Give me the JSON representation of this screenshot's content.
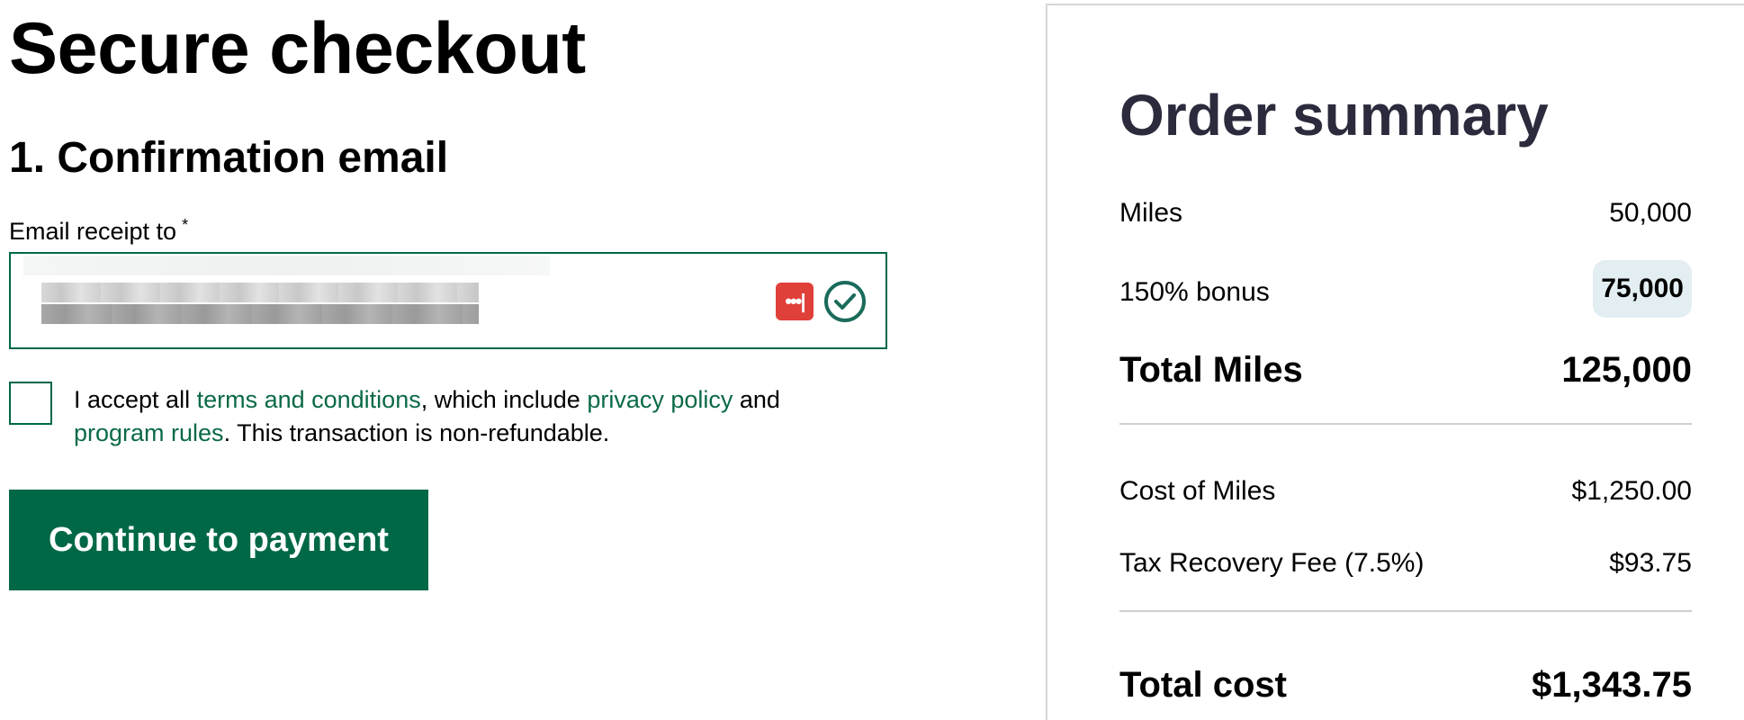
{
  "checkout": {
    "page_title": "Secure checkout",
    "section_title": "1. Confirmation email",
    "email_label": "Email receipt to",
    "required_marker": "*",
    "email_value": "",
    "password_manager_icon": "password-manager-icon",
    "valid_icon": "checkmark-circle-icon",
    "accept": {
      "prefix": "I accept all ",
      "terms_link": "terms and conditions",
      "middle": ", which include ",
      "privacy_link": "privacy policy",
      "and": " and ",
      "rules_link": "program rules",
      "suffix": ". This transaction is non-refundable.",
      "checked": false
    },
    "continue_button": "Continue to payment"
  },
  "summary": {
    "title": "Order summary",
    "rows": [
      {
        "label": "Miles",
        "value": "50,000"
      },
      {
        "label": "150% bonus",
        "value": "75,000"
      },
      {
        "label": "Total Miles",
        "value": "125,000"
      },
      {
        "label": "Cost of Miles",
        "value": "$1,250.00"
      },
      {
        "label": "Tax Recovery Fee (7.5%)",
        "value": "$93.75"
      },
      {
        "label": "Total cost",
        "value": "$1,343.75"
      }
    ]
  },
  "colors": {
    "primary_green": "#006847",
    "link_green": "#0a6a45",
    "badge_bg": "#e2eef2",
    "password_manager_red": "#e0403a",
    "summary_title": "#2b2b3d"
  }
}
